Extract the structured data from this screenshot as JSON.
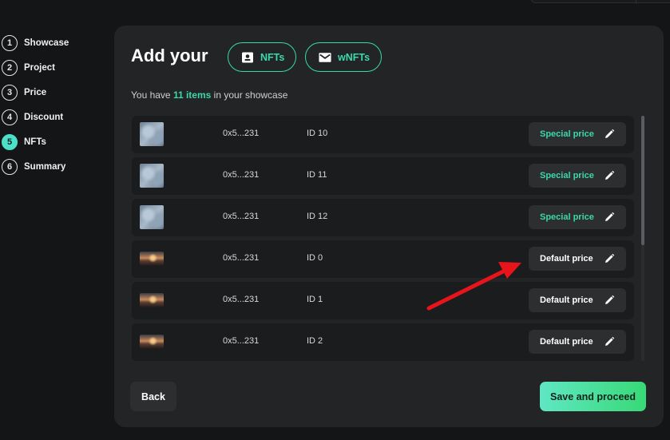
{
  "steps": [
    {
      "num": "1",
      "label": "Showcase"
    },
    {
      "num": "2",
      "label": "Project"
    },
    {
      "num": "3",
      "label": "Price"
    },
    {
      "num": "4",
      "label": "Discount"
    },
    {
      "num": "5",
      "label": "NFTs",
      "active": true
    },
    {
      "num": "6",
      "label": "Summary"
    }
  ],
  "header": {
    "title": "Add your",
    "tabs": [
      {
        "label": "NFTs",
        "icon": "id-card-icon"
      },
      {
        "label": "wNFTs",
        "icon": "envelope-icon"
      }
    ]
  },
  "summary": {
    "prefix": "You have",
    "count_text": "11 items",
    "suffix": "in your showcase"
  },
  "items": [
    {
      "thumb": "cloud",
      "address": "0x5...231",
      "token_id": "ID 10",
      "price_label": "Special price",
      "special": true
    },
    {
      "thumb": "cloud",
      "address": "0x5...231",
      "token_id": "ID 11",
      "price_label": "Special price",
      "special": true
    },
    {
      "thumb": "cloud",
      "address": "0x5...231",
      "token_id": "ID 12",
      "price_label": "Special price",
      "special": true
    },
    {
      "thumb": "sunset",
      "address": "0x5...231",
      "token_id": "ID 0",
      "price_label": "Default price",
      "special": false
    },
    {
      "thumb": "sunset",
      "address": "0x5...231",
      "token_id": "ID 1",
      "price_label": "Default price",
      "special": false
    },
    {
      "thumb": "sunset",
      "address": "0x5...231",
      "token_id": "ID 2",
      "price_label": "Default price",
      "special": false
    }
  ],
  "footer": {
    "back_label": "Back",
    "save_label": "Save and proceed"
  },
  "colors": {
    "accent": "#39d9a9",
    "active_step": "#4ce0c8",
    "annotation_arrow": "#e8141b"
  }
}
